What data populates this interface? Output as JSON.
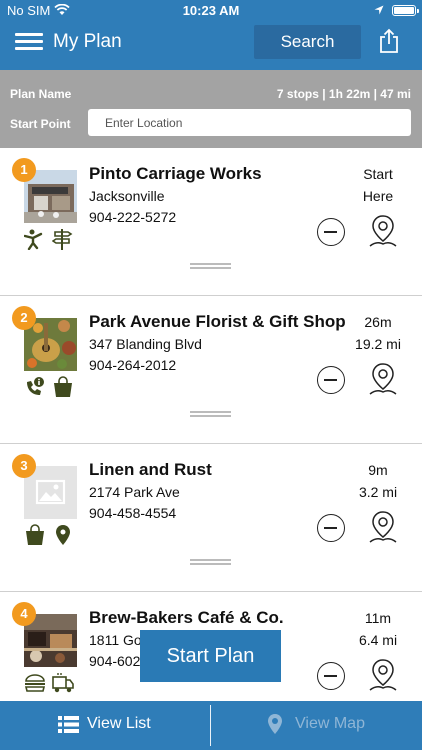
{
  "status_bar": {
    "carrier": "No SIM",
    "time": "10:23 AM"
  },
  "header": {
    "title": "My Plan",
    "search_label": "Search"
  },
  "plan": {
    "name_label": "Plan Name",
    "summary": "7 stops | 1h 22m | 47 mi",
    "start_label": "Start Point",
    "start_placeholder": "Enter Location"
  },
  "stops": [
    {
      "num": "1",
      "name": "Pinto Carriage Works",
      "addr": "Jacksonville",
      "phone": "904-222-5272",
      "time": "Start",
      "dist": "Here",
      "amenities": [
        "dance-icon",
        "signpost-icon"
      ]
    },
    {
      "num": "2",
      "name": "Park Avenue Florist & Gift Shop",
      "addr": "347 Blanding Blvd",
      "phone": "904-264-2012",
      "time": "26m",
      "dist": "19.2 mi",
      "amenities": [
        "phone-info-icon",
        "shopping-bag-icon"
      ]
    },
    {
      "num": "3",
      "name": "Linen and Rust",
      "addr": "2174 Park Ave",
      "phone": "904-458-4554",
      "time": "9m",
      "dist": "3.2 mi",
      "amenities": [
        "shopping-bag-icon",
        "location-pin-icon"
      ]
    },
    {
      "num": "4",
      "name": "Brew-Bakers Café & Co.",
      "addr": "1811 Go",
      "phone": "904-602",
      "time": "11m",
      "dist": "6.4 mi",
      "amenities": [
        "burger-icon",
        "food-truck-icon"
      ]
    }
  ],
  "actions": {
    "start_plan": "Start Plan"
  },
  "tabs": {
    "view_list": "View List",
    "view_map": "View Map"
  },
  "colors": {
    "header": "#2f7db8",
    "badge": "#f29a1f",
    "amenity": "#3f4a1e",
    "planbar": "#a3a3a3"
  }
}
